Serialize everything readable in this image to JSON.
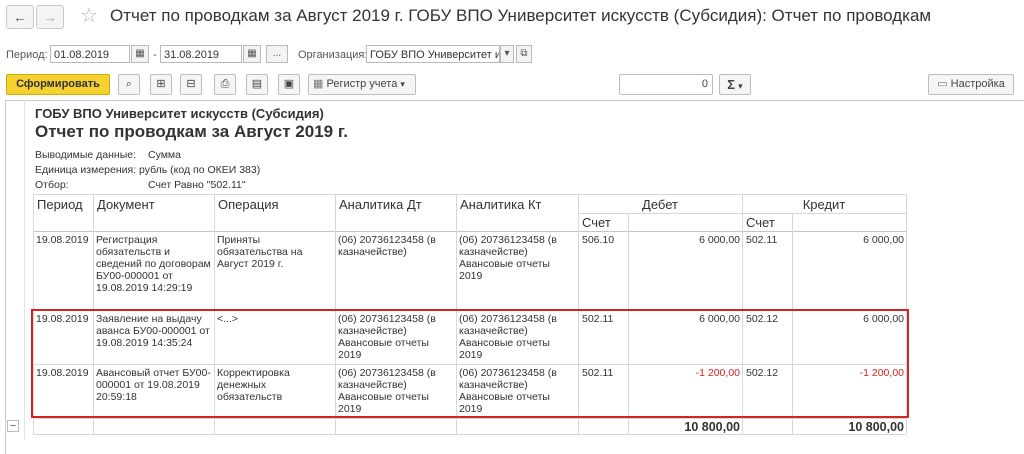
{
  "window": {
    "title": "Отчет по проводкам за Август 2019 г. ГОБУ ВПО Университет искусств (Субсидия): Отчет по проводкам"
  },
  "params": {
    "period_label": "Период:",
    "date_from": "01.08.2019",
    "date_to": "31.08.2019",
    "ellipsis": "...",
    "org_label": "Организация:",
    "org_value": "ГОБУ ВПО Университет и"
  },
  "toolbar": {
    "generate": "Сформировать",
    "register": "Регистр учета",
    "counter": "0",
    "sum_symbol": "Σ",
    "settings": "Настройка"
  },
  "report": {
    "org": "ГОБУ ВПО Университет искусств (Субсидия)",
    "title": "Отчет по проводкам за Август 2019 г.",
    "meta": [
      {
        "label": "Выводимые данные:",
        "value": "Сумма"
      },
      {
        "label": "Единица измерения:",
        "value": "рубль (код по ОКЕИ 383)"
      },
      {
        "label": "Отбор:",
        "value": "Счет Равно \"502.11\""
      }
    ],
    "columns": {
      "period": "Период",
      "document": "Документ",
      "operation": "Операция",
      "an_dt": "Аналитика Дт",
      "an_kt": "Аналитика Кт",
      "debit": "Дебет",
      "credit": "Кредит",
      "account": "Счет"
    },
    "rows": [
      {
        "date": "19.08.2019",
        "doc": "Регистрация обязательств и сведений по договорам БУ00-000001 от 19.08.2019 14:29:19",
        "op": "Приняты обязательства на Август 2019 г.",
        "an_dt": "(06) 20736123458 (в казначействе)",
        "an_kt": "(06) 20736123458 (в казначействе) Авансовые отчеты 2019",
        "dt_acc": "506.10",
        "dt_sum": "6 000,00",
        "kt_acc": "502.11",
        "kt_sum": "6 000,00",
        "negative": false
      },
      {
        "date": "19.08.2019",
        "doc": "Заявление на выдачу аванса БУ00-000001 от 19.08.2019 14:35:24",
        "op": "<...>",
        "an_dt": "(06) 20736123458 (в казначействе) Авансовые отчеты 2019",
        "an_kt": "(06) 20736123458 (в казначействе) Авансовые отчеты 2019",
        "dt_acc": "502.11",
        "dt_sum": "6 000,00",
        "kt_acc": "502.12",
        "kt_sum": "6 000,00",
        "negative": false
      },
      {
        "date": "19.08.2019",
        "doc": "Авансовый отчет БУ00-000001 от 19.08.2019 20:59:18",
        "op": "Корректировка денежных обязательств",
        "an_dt": "(06) 20736123458 (в казначействе) Авансовые отчеты 2019",
        "an_kt": "(06) 20736123458 (в казначействе) Авансовые отчеты 2019",
        "dt_acc": "502.11",
        "dt_sum": "-1 200,00",
        "kt_acc": "502.12",
        "kt_sum": "-1 200,00",
        "negative": true
      }
    ],
    "totals": {
      "debit": "10 800,00",
      "credit": "10 800,00"
    },
    "collapse_symbol": "−"
  },
  "colors": {
    "accent_button": "#f5d132",
    "negative_amount": "#d32222",
    "highlight_frame": "#d32424"
  }
}
